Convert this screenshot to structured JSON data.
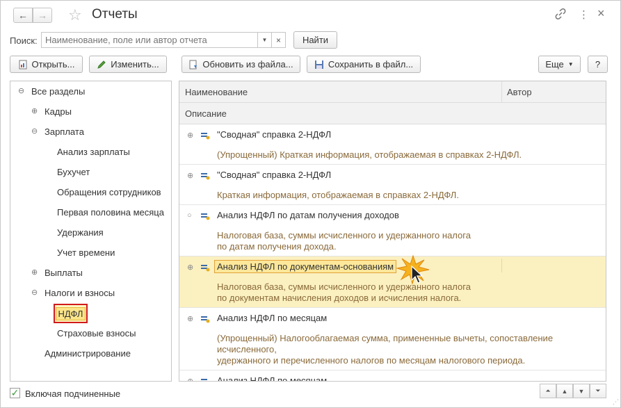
{
  "window": {
    "title": "Отчеты",
    "back_icon": "←",
    "forward_icon": "→",
    "link_icon": "🔗",
    "more_icon": "⋮",
    "close_icon": "×"
  },
  "search": {
    "label": "Поиск:",
    "placeholder": "Наименование, поле или автор отчета",
    "value": "",
    "clear_icon": "×",
    "find_label": "Найти"
  },
  "toolbar": {
    "open_label": "Открыть...",
    "edit_label": "Изменить...",
    "update_label": "Обновить из файла...",
    "save_label": "Сохранить в файл...",
    "more_label": "Еще",
    "help_label": "?"
  },
  "tree": {
    "items": [
      {
        "label": "Все разделы",
        "toggle": "⊖"
      },
      {
        "label": "Кадры",
        "toggle": "⊕"
      },
      {
        "label": "Зарплата",
        "toggle": "⊖"
      },
      {
        "label": "Анализ зарплаты",
        "toggle": ""
      },
      {
        "label": "Бухучет",
        "toggle": ""
      },
      {
        "label": "Обращения сотрудников",
        "toggle": ""
      },
      {
        "label": "Первая половина месяца",
        "toggle": ""
      },
      {
        "label": "Удержания",
        "toggle": ""
      },
      {
        "label": "Учет времени",
        "toggle": ""
      },
      {
        "label": "Выплаты",
        "toggle": "⊕"
      },
      {
        "label": "Налоги и взносы",
        "toggle": "⊖"
      },
      {
        "label": "НДФЛ",
        "toggle": ""
      },
      {
        "label": "Страховые взносы",
        "toggle": ""
      },
      {
        "label": "Администрирование",
        "toggle": ""
      }
    ]
  },
  "include_sub": {
    "label": "Включая подчиненные",
    "checked": true,
    "mark": "✓"
  },
  "list": {
    "col_name": "Наименование",
    "col_author": "Автор",
    "col_desc": "Описание",
    "rows": [
      {
        "toggle": "⊕",
        "title": "\"Сводная\" справка 2-НДФЛ",
        "desc1": "(Упрощенный) Краткая информация, отображаемая в справках 2-НДФЛ.",
        "desc2": "",
        "desc3": ""
      },
      {
        "toggle": "⊕",
        "title": "\"Сводная\" справка 2-НДФЛ",
        "desc1": "Краткая информация, отображаемая в справках 2-НДФЛ.",
        "desc2": "",
        "desc3": ""
      },
      {
        "toggle": "○",
        "title": "Анализ НДФЛ по датам получения доходов",
        "desc1": "Налоговая база, суммы исчисленного и удержанного налога",
        "desc2": "по датам получения дохода.",
        "desc3": ""
      },
      {
        "toggle": "⊕",
        "title": "Анализ НДФЛ по документам-основаниям",
        "desc1": "Налоговая база, суммы исчисленного и удержанного налога",
        "desc2": "по документам начисления доходов и исчисления налога.",
        "desc3": ""
      },
      {
        "toggle": "⊕",
        "title": "Анализ НДФЛ по месяцам",
        "desc1": "(Упрощенный) Налогооблагаемая сумма, примененные вычеты, сопоставление",
        "desc2": "исчисленного,",
        "desc3": "удержанного и перечисленного налогов по месяцам налогового периода."
      },
      {
        "toggle": "⊕",
        "title": "Анализ НДФЛ по месяцам",
        "desc1": "",
        "desc2": "",
        "desc3": ""
      }
    ]
  },
  "colors": {
    "active_row": "#fbf0c0",
    "selection_border": "#d11a1a",
    "desc_text": "#8a6a3a"
  }
}
